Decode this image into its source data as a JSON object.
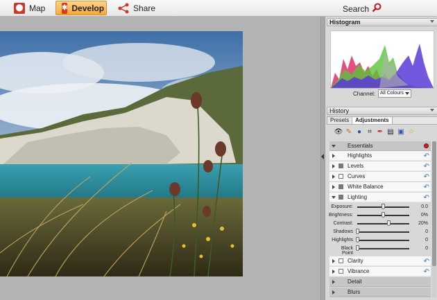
{
  "toolbar": {
    "map_label": "Map",
    "develop_label": "Develop",
    "share_label": "Share",
    "search_label": "Search"
  },
  "histogram": {
    "title": "Histogram",
    "channel_label": "Channel:",
    "channel_value": "All Colours"
  },
  "history": {
    "title": "History"
  },
  "tabs": [
    {
      "label": "Presets",
      "active": false
    },
    {
      "label": "Adjustments",
      "active": true
    }
  ],
  "tool_icons": [
    "eye-icon",
    "brush-icon",
    "spot-icon",
    "crop-icon",
    "pen-icon",
    "compare-icon",
    "save-icon",
    "star-icon"
  ],
  "adjustments": {
    "essentials": "Essentials",
    "highlights": "Highlights",
    "levels": "Levels",
    "curves": "Curves",
    "white_balance": "White Balance",
    "lighting": "Lighting",
    "clarity": "Clarity",
    "vibrance": "Vibrance",
    "detail": "Detail",
    "blurs": "Blurs"
  },
  "lighting_sliders": [
    {
      "label": "Exposure:",
      "value": "0.0",
      "level": 0.5
    },
    {
      "label": "Brightness:",
      "value": "0%",
      "level": 0.5
    },
    {
      "label": "Contrast:",
      "value": "20%",
      "level": 0.6
    },
    {
      "label": "Shadows",
      "value": "0",
      "level": 0
    },
    {
      "label": "Highlights",
      "value": "0",
      "level": 0
    },
    {
      "label": "Black Point",
      "value": "0",
      "level": 0
    }
  ],
  "colors": {
    "accent": "#f5a93a",
    "essentials_dot": "#cc1f1f",
    "histogram_red": "#e0306a",
    "histogram_green": "#5ac23a",
    "histogram_blue": "#5a3ad8"
  }
}
